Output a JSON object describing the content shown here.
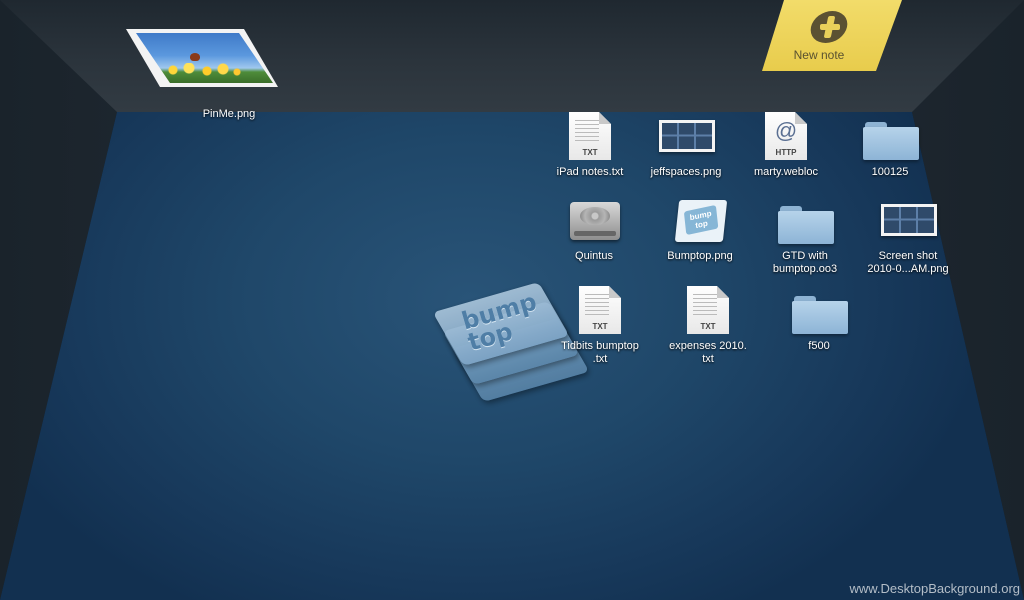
{
  "wall": {
    "pinned_image": {
      "label": "PinMe.png",
      "icon": "image-thumbnail-icon"
    },
    "sticky_note": {
      "label": "New note",
      "icon": "plus-icon"
    }
  },
  "desktop": {
    "items": [
      {
        "label": "iPad notes.txt",
        "icon": "text-file-icon",
        "badge": "TXT"
      },
      {
        "label": "jeffspaces.png",
        "icon": "image-file-icon"
      },
      {
        "label": "marty.webloc",
        "icon": "webloc-file-icon",
        "badge": "HTTP",
        "glyph": "@"
      },
      {
        "label": "100125",
        "icon": "folder-icon"
      },
      {
        "label": "Quintus",
        "icon": "hard-drive-icon"
      },
      {
        "label": "Bumptop.png",
        "icon": "image-file-icon",
        "glyph": "bump\ntop"
      },
      {
        "label": "GTD with\nbumptop.oo3",
        "icon": "folder-icon"
      },
      {
        "label": "Screen shot\n2010-0...AM.png",
        "icon": "image-file-icon"
      },
      {
        "label": "Tidbits bumptop\n.txt",
        "icon": "text-file-icon",
        "badge": "TXT"
      },
      {
        "label": "expenses 2010.\ntxt",
        "icon": "text-file-icon",
        "badge": "TXT"
      },
      {
        "label": "f500",
        "icon": "folder-icon"
      }
    ]
  },
  "logo": {
    "text": "bump\ntop",
    "icon": "bumptop-logo-icon"
  },
  "watermark": "www.DesktopBackground.org"
}
